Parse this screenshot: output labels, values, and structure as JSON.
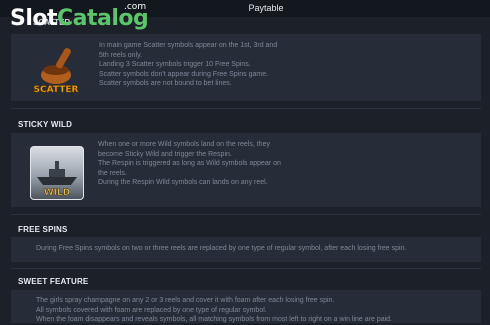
{
  "header": {
    "title": "Paytable"
  },
  "watermark": {
    "slot": "Slot",
    "catalog": "Catalog",
    "com": ".com"
  },
  "sections": {
    "scatter": {
      "title_peek": "SCATTER",
      "icon_label": "SCATTER",
      "lines": [
        "In main game Scatter symbols appear on the 1st, 3rd and",
        "5th reels only.",
        "Landing 3 Scatter symbols trigger 10 Free Spins.",
        "Scatter symbols don't appear during Free Spins game.",
        "Scatter symbols are not bound to bet lines."
      ]
    },
    "sticky_wild": {
      "title": "STICKY WILD",
      "icon_label": "WILD",
      "lines": [
        "When one or more Wild symbols land on the reels, they",
        "become Sticky Wild and trigger the Respin.",
        "The Respin is triggered as long as Wild symbols appear on",
        "the reels.",
        "During the Respin Wild symbols can lands on any reel."
      ]
    },
    "free_spins": {
      "title": "FREE SPINS",
      "lines": [
        "During Free Spins symbols on two or three reels are replaced by one type of regular symbol, after each losing free spin."
      ]
    },
    "sweet_feature": {
      "title": "SWEET FEATURE",
      "lines": [
        "The girls spray champagne on any 2 or 3 reels and cover it with foam after each losing free spin.",
        "All symbols covered with foam are replaced by one type of regular symbol.",
        "When the foam disappears and reveals symbols, all matching symbols from most left to right on a win line are paid."
      ]
    }
  },
  "colors": {
    "background": "#1b2029",
    "panel": "#272d38",
    "heading": "#e8eaee",
    "body_text": "#7e8899",
    "logo_green": "#5cc46b",
    "scatter_gold": "#f2b705"
  }
}
